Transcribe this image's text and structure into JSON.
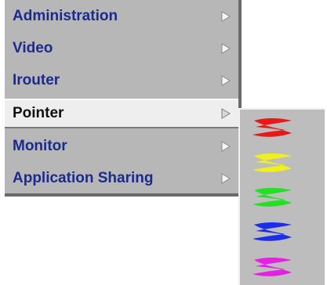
{
  "menu": {
    "items": [
      {
        "label": "Administration",
        "active": false
      },
      {
        "label": "Video",
        "active": false
      },
      {
        "label": "Irouter",
        "active": false
      },
      {
        "label": "Pointer",
        "active": true
      },
      {
        "label": "Monitor",
        "active": false
      },
      {
        "label": "Application Sharing",
        "active": false
      }
    ]
  },
  "submenu": {
    "items": [
      {
        "icon": "red-pointer-icon",
        "color": "#e81818"
      },
      {
        "icon": "yellow-pointer-icon",
        "color": "#f0f01c"
      },
      {
        "icon": "green-pointer-icon",
        "color": "#22e022"
      },
      {
        "icon": "blue-pointer-icon",
        "color": "#1b2ee8"
      },
      {
        "icon": "magenta-pointer-icon",
        "color": "#e61ee6"
      }
    ]
  }
}
